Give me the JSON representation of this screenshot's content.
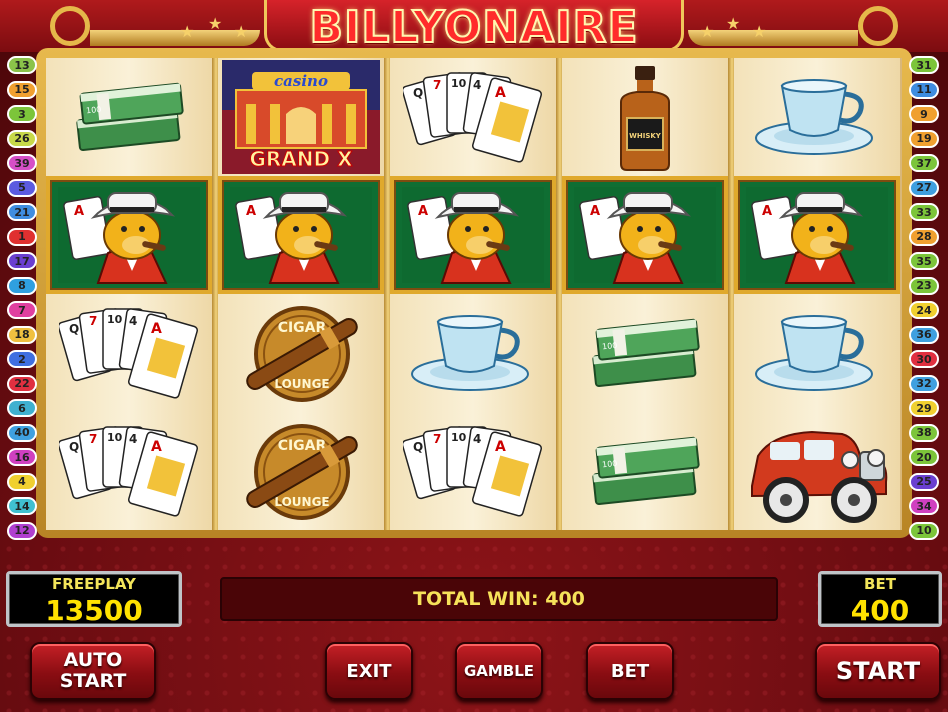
{
  "title": "BILLYONAIRE",
  "reels": [
    [
      "money-stack",
      "casino-grand-x",
      "playing-cards",
      "whisky-bottle",
      "tea-cup"
    ],
    [
      "gangster-dog",
      "gangster-dog",
      "gangster-dog",
      "gangster-dog",
      "gangster-dog"
    ],
    [
      "playing-cards",
      "cigar-lounge",
      "tea-cup",
      "money-stack",
      "tea-cup"
    ],
    [
      "playing-cards",
      "cigar-lounge",
      "playing-cards",
      "money-stack",
      "vintage-car"
    ]
  ],
  "symbol_text": {
    "casino": "casino",
    "grand_x": "GRAND X",
    "whisky": "WHISKY",
    "cigar": "CIGAR",
    "lounge": "LOUNGE"
  },
  "lines_left": [
    {
      "n": "13",
      "c": "#8bc34a"
    },
    {
      "n": "15",
      "c": "#f0a030"
    },
    {
      "n": "3",
      "c": "#7cc53a"
    },
    {
      "n": "26",
      "c": "#c7d94a"
    },
    {
      "n": "39",
      "c": "#d64fc7"
    },
    {
      "n": "5",
      "c": "#5b5be0"
    },
    {
      "n": "21",
      "c": "#3f8de0"
    },
    {
      "n": "1",
      "c": "#e03030"
    },
    {
      "n": "17",
      "c": "#6a3fd0"
    },
    {
      "n": "8",
      "c": "#2fa0e0"
    },
    {
      "n": "7",
      "c": "#e040a0"
    },
    {
      "n": "18",
      "c": "#f0c040"
    },
    {
      "n": "2",
      "c": "#3f6fe0"
    },
    {
      "n": "22",
      "c": "#e03040"
    },
    {
      "n": "6",
      "c": "#3fb0d0"
    },
    {
      "n": "40",
      "c": "#3fa0e0"
    },
    {
      "n": "16",
      "c": "#d040c0"
    },
    {
      "n": "4",
      "c": "#f0d030"
    },
    {
      "n": "14",
      "c": "#40c0d0"
    },
    {
      "n": "12",
      "c": "#b040d0"
    }
  ],
  "lines_right": [
    {
      "n": "31",
      "c": "#7cc53a"
    },
    {
      "n": "11",
      "c": "#3f8de0"
    },
    {
      "n": "9",
      "c": "#f0a030"
    },
    {
      "n": "19",
      "c": "#f0a030"
    },
    {
      "n": "37",
      "c": "#7cc53a"
    },
    {
      "n": "27",
      "c": "#3fa0e0"
    },
    {
      "n": "33",
      "c": "#7cc53a"
    },
    {
      "n": "28",
      "c": "#f0a030"
    },
    {
      "n": "35",
      "c": "#7cc53a"
    },
    {
      "n": "23",
      "c": "#7cc53a"
    },
    {
      "n": "24",
      "c": "#f0d030"
    },
    {
      "n": "36",
      "c": "#3fa0e0"
    },
    {
      "n": "30",
      "c": "#e03040"
    },
    {
      "n": "32",
      "c": "#3fa0e0"
    },
    {
      "n": "29",
      "c": "#f0d030"
    },
    {
      "n": "38",
      "c": "#7cc53a"
    },
    {
      "n": "20",
      "c": "#7cc53a"
    },
    {
      "n": "25",
      "c": "#6a3fd0"
    },
    {
      "n": "34",
      "c": "#d040c0"
    },
    {
      "n": "10",
      "c": "#7cc53a"
    }
  ],
  "panel": {
    "freeplay_label": "FREEPLAY",
    "freeplay_value": "13500",
    "total_win": "TOTAL WIN: 400",
    "bet_label": "BET",
    "bet_value": "400"
  },
  "buttons": {
    "auto_start": "AUTO START",
    "exit": "EXIT",
    "gamble": "GAMBLE",
    "bet": "BET",
    "start": "START"
  },
  "colors": {
    "win_green": "#0f6e33",
    "gold": "#e0a92c",
    "lcd_text": "#ffe200"
  }
}
